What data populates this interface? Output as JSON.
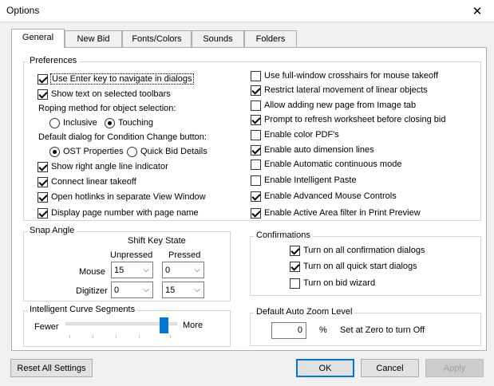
{
  "window": {
    "title": "Options",
    "close_glyph": "✕"
  },
  "tabs": [
    {
      "label": "General",
      "active": true
    },
    {
      "label": "New Bid",
      "active": false
    },
    {
      "label": "Fonts/Colors",
      "active": false
    },
    {
      "label": "Sounds",
      "active": false
    },
    {
      "label": "Folders",
      "active": false
    }
  ],
  "preferences": {
    "legend": "Preferences",
    "use_enter_key": {
      "label": "Use Enter key to navigate in dialogs",
      "checked": true
    },
    "show_text_toolbars": {
      "label": "Show text on selected toolbars",
      "checked": true
    },
    "roping_label": "Roping method for object selection:",
    "roping_inclusive": {
      "label": "Inclusive",
      "checked": false
    },
    "roping_touching": {
      "label": "Touching",
      "checked": true
    },
    "default_dialog_label": "Default dialog for Condition Change button:",
    "dialog_ost_properties": {
      "label": "OST Properties",
      "checked": true
    },
    "dialog_quick_bid_details": {
      "label": "Quick Bid Details",
      "checked": false
    },
    "show_right_angle": {
      "label": "Show right angle line indicator",
      "checked": true
    },
    "connect_linear": {
      "label": "Connect linear takeoff",
      "checked": true
    },
    "open_hotlinks": {
      "label": "Open hotlinks in separate View Window",
      "checked": true
    },
    "display_page_number": {
      "label": "Display page number with page name",
      "checked": true
    },
    "full_window_crosshairs": {
      "label": "Use full-window crosshairs for mouse takeoff",
      "checked": false
    },
    "restrict_lateral": {
      "label": "Restrict lateral movement of linear objects",
      "checked": true
    },
    "allow_new_page": {
      "label": "Allow adding new page from Image tab",
      "checked": false
    },
    "prompt_refresh": {
      "label": "Prompt to refresh worksheet before closing bid",
      "checked": true
    },
    "enable_color_pdf": {
      "label": "Enable color PDF's",
      "checked": false
    },
    "enable_auto_dimension": {
      "label": "Enable auto dimension lines",
      "checked": true
    },
    "enable_auto_continuous": {
      "label": "Enable Automatic continuous mode",
      "checked": false
    },
    "enable_intelligent_paste": {
      "label": "Enable Intelligent Paste",
      "checked": false
    },
    "enable_advanced_mouse": {
      "label": "Enable Advanced Mouse Controls",
      "checked": true
    },
    "enable_active_area": {
      "label": "Enable Active Area filter in Print Preview",
      "checked": true
    }
  },
  "snap_angle": {
    "legend": "Snap Angle",
    "shift_key_state": "Shift Key State",
    "unpressed": "Unpressed",
    "pressed": "Pressed",
    "mouse_label": "Mouse",
    "digitizer_label": "Digitizer",
    "mouse_unpressed": "15",
    "mouse_pressed": "0",
    "digitizer_unpressed": "0",
    "digitizer_pressed": "15"
  },
  "curve_segments": {
    "legend": "Intelligent Curve Segments",
    "fewer": "Fewer",
    "more": "More",
    "level": 0.88
  },
  "confirmations": {
    "legend": "Confirmations",
    "all_confirmation_dialogs": {
      "label": "Turn on all confirmation dialogs",
      "checked": true
    },
    "all_quick_start_dialogs": {
      "label": "Turn on all quick start dialogs",
      "checked": true
    },
    "bid_wizard": {
      "label": "Turn on bid wizard",
      "checked": false
    }
  },
  "auto_zoom": {
    "legend": "Default Auto Zoom Level",
    "value": "0",
    "unit": "%",
    "hint": "Set at Zero to turn Off"
  },
  "buttons": {
    "reset": "Reset All Settings",
    "ok": "OK",
    "cancel": "Cancel",
    "apply": "Apply"
  },
  "icons": {
    "dropdown": "chevron-down-icon",
    "close": "close-icon"
  }
}
